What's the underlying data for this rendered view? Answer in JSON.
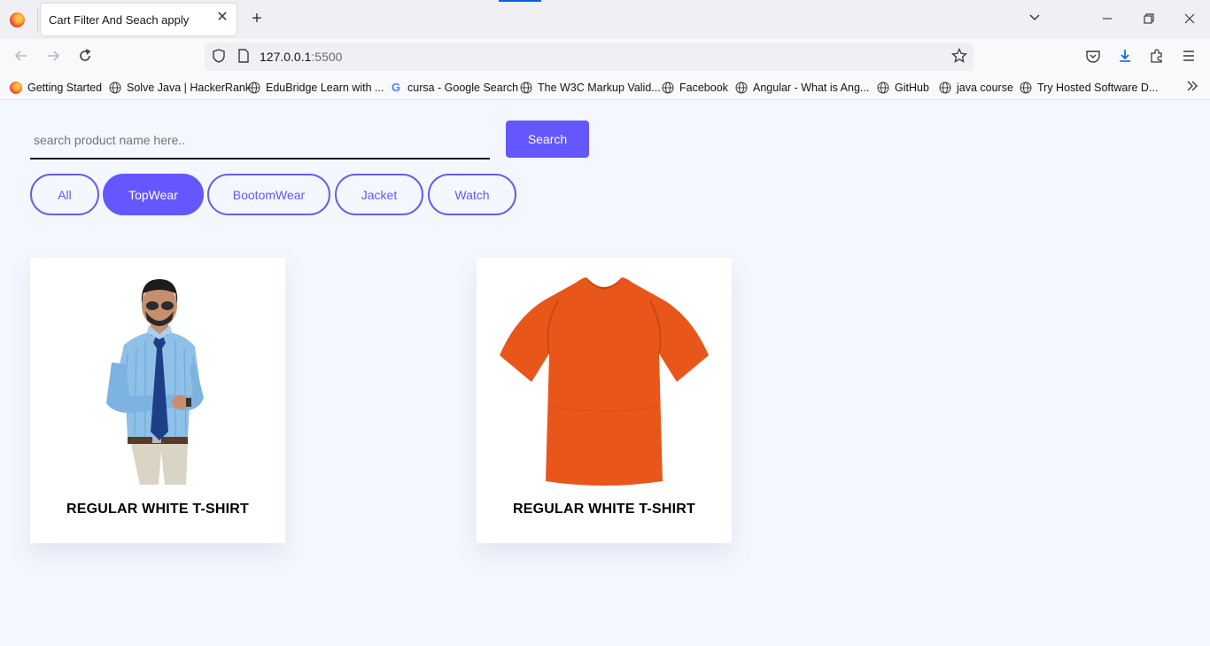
{
  "browser": {
    "tab_title": "Cart Filter And Seach apply",
    "url_host": "127.0.0.1",
    "url_port": ":5500",
    "bookmarks": [
      "Getting Started",
      "Solve Java | HackerRank",
      "EduBridge Learn with ...",
      "cursa - Google Search",
      "The W3C Markup Valid...",
      "Facebook",
      "Angular - What is Ang...",
      "GitHub",
      "java course",
      "Try Hosted Software D..."
    ]
  },
  "search": {
    "placeholder": "search product name here..",
    "button_label": "Search"
  },
  "filters": [
    {
      "label": "All",
      "active": false
    },
    {
      "label": "TopWear",
      "active": true
    },
    {
      "label": "BootomWear",
      "active": false
    },
    {
      "label": "Jacket",
      "active": false
    },
    {
      "label": "Watch",
      "active": false
    }
  ],
  "products": [
    {
      "name": "REGULAR WHITE T-SHIRT",
      "image": "man-in-blue-shirt"
    },
    {
      "name": "REGULAR WHITE T-SHIRT",
      "image": "orange-t-shirt"
    }
  ],
  "colors": {
    "accent": "#6357fd",
    "page_background": "#f5f7fe",
    "tshirt": "#e8561a"
  }
}
